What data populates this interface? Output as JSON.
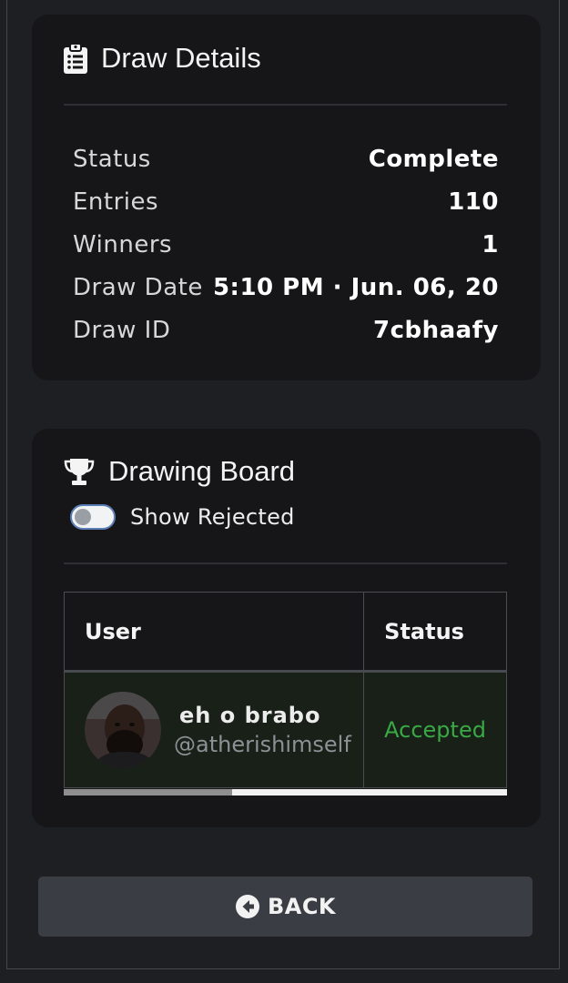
{
  "details": {
    "title": "Draw Details",
    "title_icon": "clipboard-list-icon",
    "rows": [
      {
        "label": "Status",
        "value": "Complete"
      },
      {
        "label": "Entries",
        "value": "110"
      },
      {
        "label": "Winners",
        "value": "1"
      },
      {
        "label": "Draw Date",
        "value": "5:10 PM · Jun. 06, 20"
      },
      {
        "label": "Draw ID",
        "value": "7cbhaafy"
      }
    ]
  },
  "board": {
    "title": "Drawing Board",
    "title_icon": "trophy-icon",
    "toggle_label": "Show Rejected",
    "toggle_on": false,
    "columns": [
      "User",
      "Status"
    ],
    "rows": [
      {
        "display_name": "eh o brabo",
        "handle": "@atherishimself",
        "status": "Accepted",
        "status_color": "#39a845"
      }
    ]
  },
  "back_button": {
    "label": "BACK",
    "icon": "arrow-circle-left-icon"
  }
}
